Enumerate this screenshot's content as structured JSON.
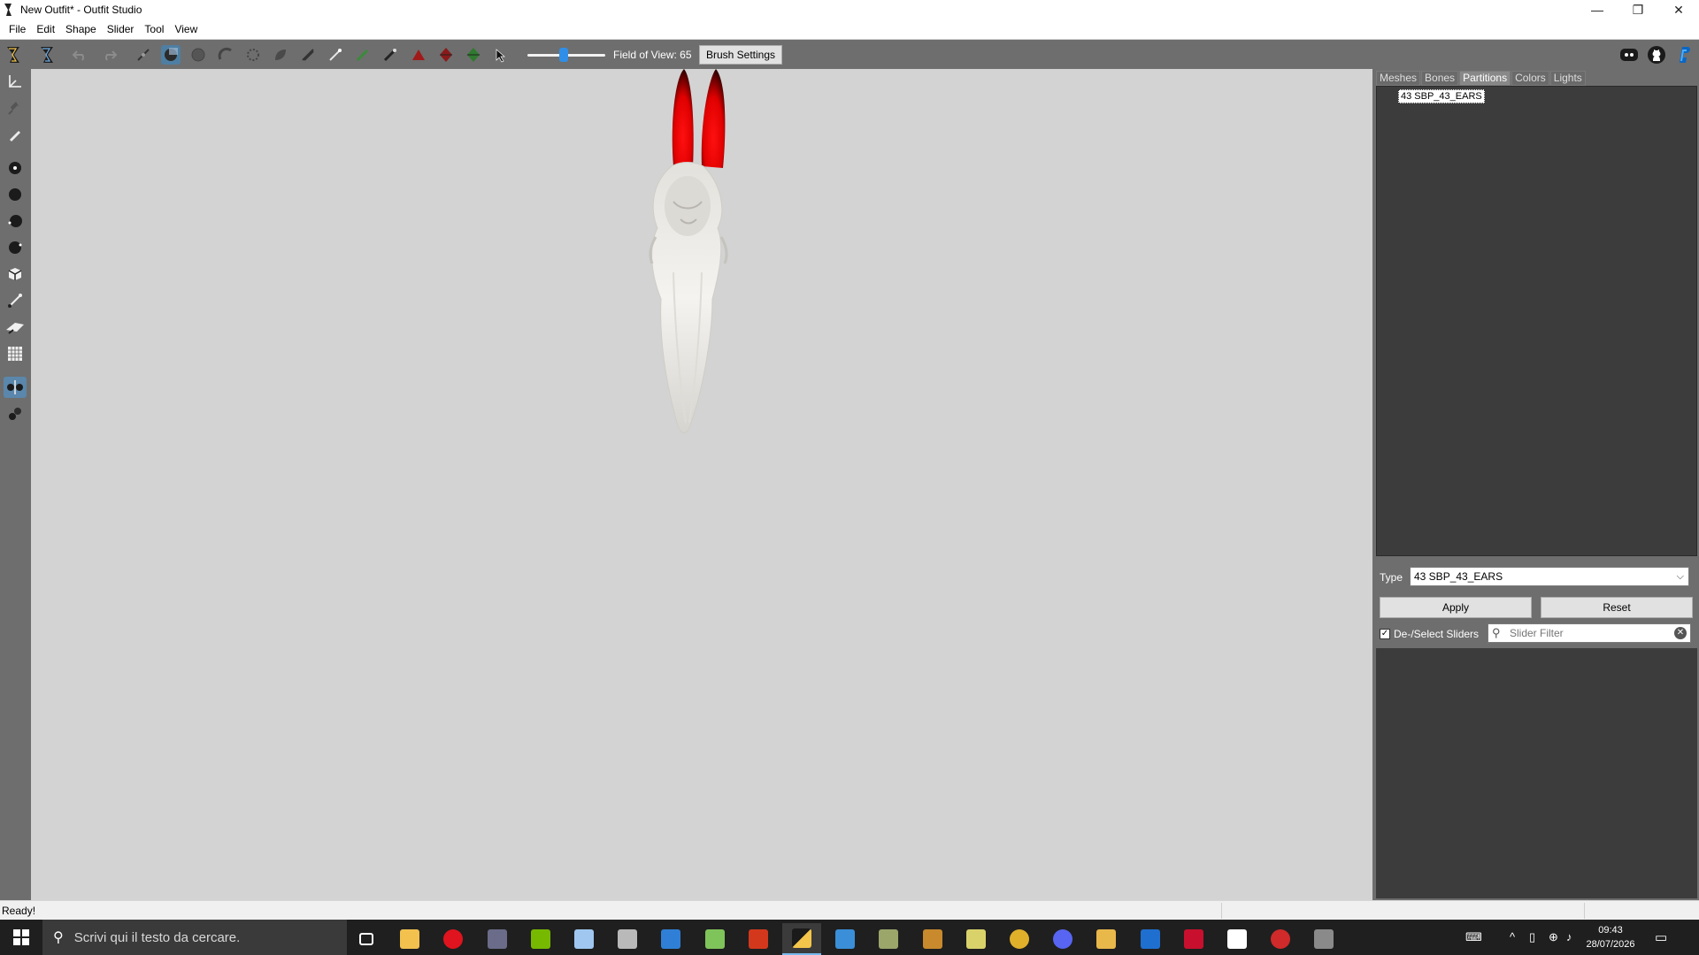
{
  "window": {
    "title": "New Outfit* - Outfit Studio",
    "min_glyph": "—",
    "restore_glyph": "❐",
    "close_glyph": "✕"
  },
  "menu": [
    "File",
    "Edit",
    "Shape",
    "Slider",
    "Tool",
    "View"
  ],
  "toolbar": {
    "icons": [
      "outfit-studio-logo-icon",
      "outfit-studio-alt-icon",
      "undo-icon",
      "redo-icon",
      "select-brush-icon",
      "mask-brush-icon",
      "unmask-brush-icon",
      "inflate-brush-icon",
      "deflate-brush-icon",
      "move-brush-icon",
      "smooth-brush-icon",
      "weight-brush-icon",
      "color-brush-icon",
      "alpha-brush-icon",
      "collapse-vertex-icon",
      "flip-edge-icon",
      "split-edge-icon",
      "cursor-icon"
    ],
    "fov_label": "Field of View: 65",
    "fov_value": 65,
    "fov_fraction": 0.46,
    "brush_settings": "Brush Settings",
    "right_icons": [
      "discord-icon",
      "github-icon",
      "paypal-icon"
    ]
  },
  "leftbar": {
    "icons": [
      "transform-tool-icon",
      "pivot-tool-icon",
      "pencil-tool-icon",
      "vertex-small-icon",
      "vertex-large-icon",
      "vertex-mid-icon",
      "vertex-sphere-icon",
      "cube-icon",
      "edge-tool-icon",
      "brush-weight-icon",
      "grid-icon",
      "symmetry-icon",
      "connected-icon"
    ]
  },
  "rightpanel": {
    "tabs": [
      "Meshes",
      "Bones",
      "Partitions",
      "Colors",
      "Lights"
    ],
    "active_tab": "Partitions",
    "tree_item": "43 SBP_43_EARS",
    "type_label": "Type",
    "type_value": "43 SBP_43_EARS",
    "apply": "Apply",
    "reset": "Reset",
    "deselect_label": "De-/Select Sliders",
    "deselect_checked": true,
    "filter_placeholder": "Slider Filter"
  },
  "status": {
    "text": "Ready!"
  },
  "taskbar": {
    "search_placeholder": "Scrivi qui il testo da cercare.",
    "apps": [
      "task-view-icon",
      "file-explorer-icon",
      "opera-icon",
      "app-generic-icon",
      "nvidia-icon",
      "brush-app-icon",
      "bowl-app-icon",
      "store-icon",
      "notepad-icon",
      "fallout-icon",
      "outfit-studio-icon",
      "window-app-icon",
      "printer-app-icon",
      "creature-app-icon",
      "map-app-icon",
      "chrome-icon",
      "discord-icon",
      "folder-icon",
      "blue-square-icon",
      "xedit-icon",
      "network-app-icon",
      "gear-app-icon",
      "wine-app-icon"
    ],
    "clock_time": "09:43",
    "clock_date": "28/07/2026",
    "colors": {
      "active_underline": "#76b9ed"
    }
  }
}
